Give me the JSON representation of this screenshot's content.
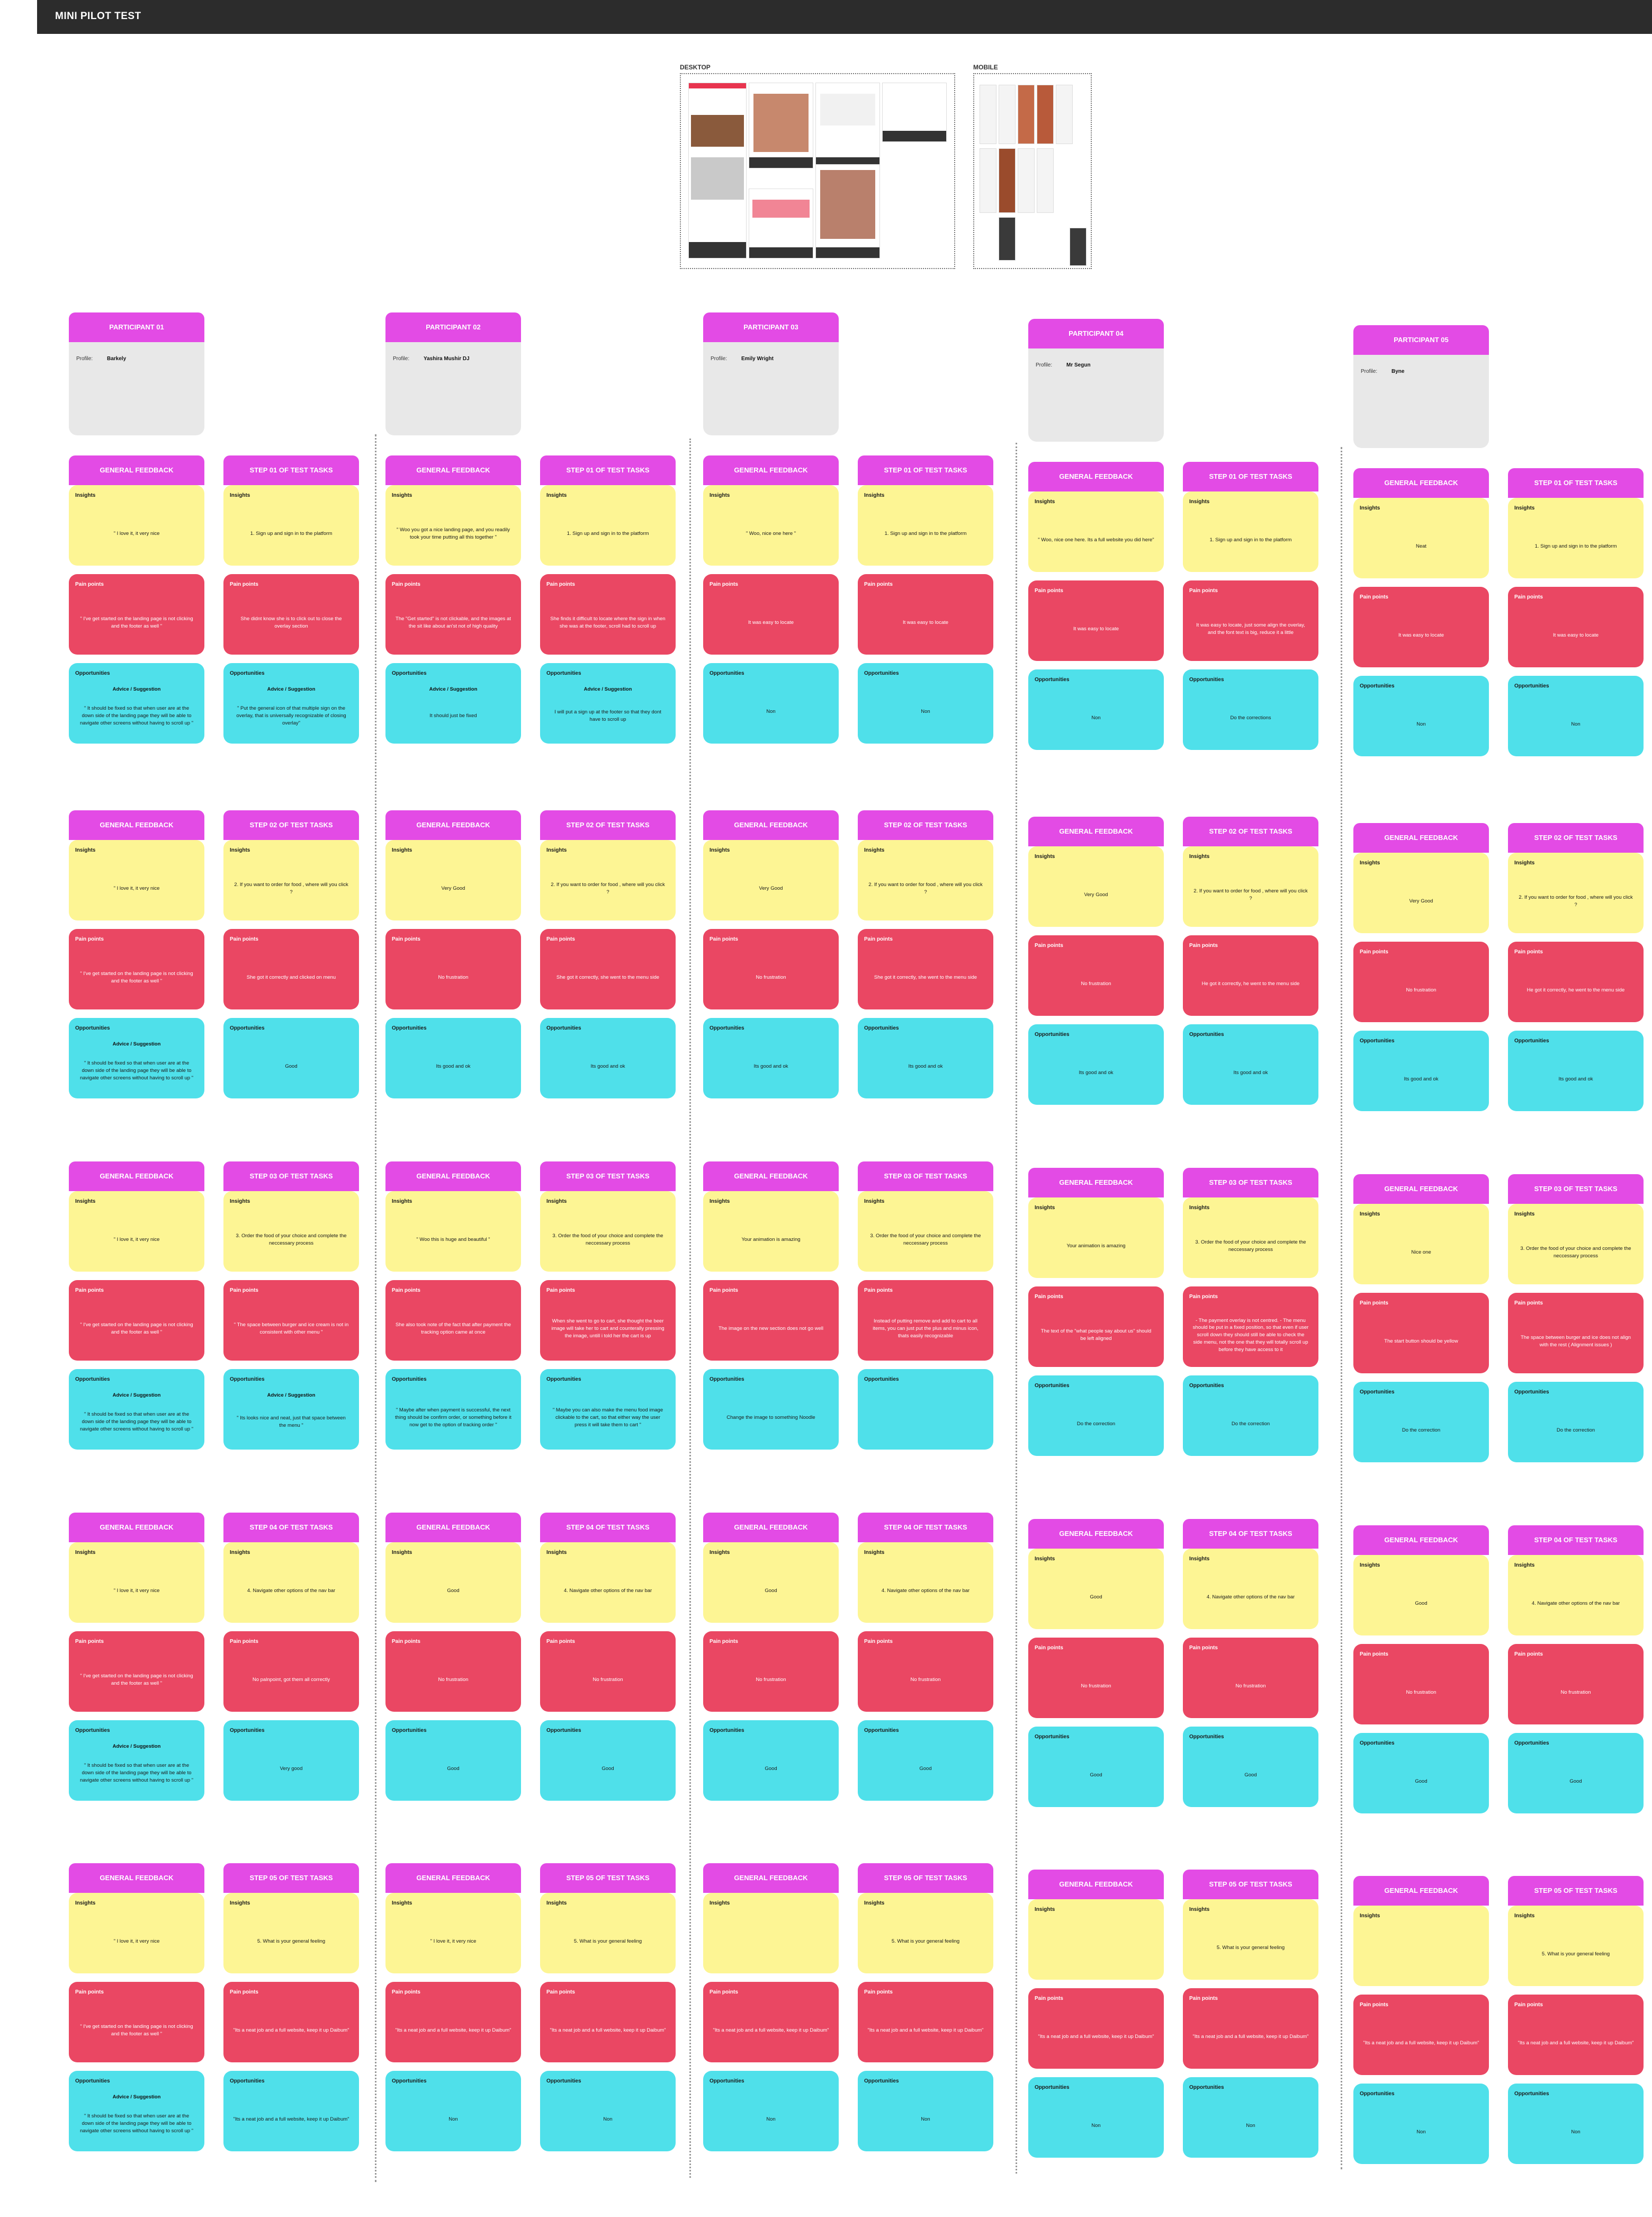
{
  "board": {
    "title": "MINI PILOT TEST"
  },
  "frames": {
    "desktop_label": "DESKTOP",
    "mobile_label": "MOBILE"
  },
  "labels": {
    "general": "GENERAL FEEDBACK",
    "insights": "Insights",
    "pain": "Pain points",
    "opp": "Opportunities",
    "advice": "Advice / Suggestion",
    "profile": "Profile:"
  },
  "colors": {
    "header": "#e34be5",
    "insight": "#fdf594",
    "pain": "#ea4763",
    "opportunity": "#4fe0ea",
    "profile": "#e8e8e8",
    "topbar": "#2c2c2c"
  },
  "participants": [
    {
      "title": "PARTICIPANT 01",
      "name": "Barkely"
    },
    {
      "title": "PARTICIPANT 02",
      "name": "Yashira Mushir DJ"
    },
    {
      "title": "PARTICIPANT 03",
      "name": "Emily Wright"
    },
    {
      "title": "PARTICIPANT 04",
      "name": "Mr Segun"
    },
    {
      "title": "PARTICIPANT 05",
      "name": "Byne"
    }
  ],
  "rows": [
    {
      "step": "STEP 01 OF TEST TASKS",
      "participants": [
        {
          "g": {
            "ins": "\" I love it, it very nice",
            "pain": "\" I've get started on the landing page is not clicking and the footer as well \"",
            "opp": "\" It should be fixed so that when user are at the down side of the landing page they will be able to navigate other screens without having to scroll up \"",
            "adv": true
          },
          "s": {
            "ins": "1. Sign up and sign in to the platform",
            "pain": "She didnt know she is to click out to close the overlay section",
            "opp": "\" Put the general icon of that multiple sign on the overlay, that is universally recognizable of closing overlay\"",
            "adv": true
          }
        },
        {
          "g": {
            "ins": "\" Woo you got a nice landing page, and you readily took your time putting all this together \"",
            "pain": "The \"Get started\" is not clickable, and the images at the sit like about an'st not of high quality",
            "opp": "It should just be fixed",
            "adv": true
          },
          "s": {
            "ins": "1. Sign up and sign in to the platform",
            "pain": "She finds it difficult to locate where the sign in when she was at the footer, scroll had to scroll up",
            "opp": "I will put a sign up at the footer so that they dont have to scroll up",
            "adv": true
          }
        },
        {
          "g": {
            "ins": "\" Woo, nice one here \"",
            "pain": "It was easy to locate",
            "opp": "Non",
            "adv": false
          },
          "s": {
            "ins": "1. Sign up and sign in to the platform",
            "pain": "It was easy to locate",
            "opp": "Non",
            "adv": false
          }
        },
        {
          "g": {
            "ins": "\" Woo, nice one here. Its a full website you did here\"",
            "pain": "It was easy to locate",
            "opp": "Non",
            "adv": false
          },
          "s": {
            "ins": "1. Sign up and sign in to the platform",
            "pain": "It was easy to locate, just some align the overlay, and the font text is big, reduce it a little",
            "opp": "Do the corrections",
            "adv": false
          }
        },
        {
          "g": {
            "ins": "Neat",
            "pain": "It was easy to locate",
            "opp": "Non",
            "adv": false
          },
          "s": {
            "ins": "1. Sign up and sign in to the platform",
            "pain": "It was easy to locate",
            "opp": "Non",
            "adv": false
          }
        }
      ]
    },
    {
      "step": "STEP 02 OF TEST TASKS",
      "participants": [
        {
          "g": {
            "ins": "\" I love it, it very nice",
            "pain": "\" I've get started on the landing page is not clicking and the footer as well \"",
            "opp": "\" It should be fixed so that when user are at the down side of the landing page they will be able to navigate other screens without having to scroll up \"",
            "adv": true
          },
          "s": {
            "ins": "2. If you want to order for food , where will you click ?",
            "pain": "She got it correctly and clicked on menu",
            "opp": "Good",
            "adv": false
          }
        },
        {
          "g": {
            "ins": "Very Good",
            "pain": "No frustration",
            "opp": "Its good and ok",
            "adv": false
          },
          "s": {
            "ins": "2. If you want to order for food , where will you click ?",
            "pain": "She got it correctly, she went to the menu side",
            "opp": "Its good and ok",
            "adv": false
          }
        },
        {
          "g": {
            "ins": "Very Good",
            "pain": "No frustration",
            "opp": "Its good and ok",
            "adv": false
          },
          "s": {
            "ins": "2. If you want to order for food , where will you click ?",
            "pain": "She got it correctly, she went to the menu side",
            "opp": "Its good and ok",
            "adv": false
          }
        },
        {
          "g": {
            "ins": "Very Good",
            "pain": "No frustration",
            "opp": "Its good and ok",
            "adv": false
          },
          "s": {
            "ins": "2. If you want to order for food , where will you click ?",
            "pain": "He got it correctly, he went to the menu side",
            "opp": "Its good and ok",
            "adv": false
          }
        },
        {
          "g": {
            "ins": "Very Good",
            "pain": "No frustration",
            "opp": "Its good and ok",
            "adv": false
          },
          "s": {
            "ins": "2. If you want to order for food , where will you click ?",
            "pain": "He got it correctly, he went to the menu side",
            "opp": "Its good and ok",
            "adv": false
          }
        }
      ]
    },
    {
      "step": "STEP 03 OF TEST TASKS",
      "participants": [
        {
          "g": {
            "ins": "\" I love it, it very nice",
            "pain": "\" I've get started on the landing page is not clicking and the footer as well \"",
            "opp": "\" It should be fixed so that when user are at the down side of the landing page they will be able to navigate other screens without having to scroll up \"",
            "adv": true
          },
          "s": {
            "ins": "3. Order the food of your choice and complete the neccessary process",
            "pain": "\" The space between burger and ice cream is not in consistent with other menu \"",
            "opp": "\" Its looks nice and neat, just that space between the menu \"",
            "adv": true
          }
        },
        {
          "g": {
            "ins": "\" Woo this is huge and beautiful \"",
            "pain": "She also took note of the fact that after payment the tracking option came at once",
            "opp": "\" Maybe after when payment is successful, the next thing should be confirm order, or something before it now get to the option of tracking order \"",
            "adv": false
          },
          "s": {
            "ins": "3. Order the food of your choice and complete the neccessary process",
            "pain": "When she went to go to cart, she thought the beer image will take her to cart and counterally pressing the image, untill i told her the cart is up",
            "opp": "\" Maybe you can also make the menu food image clickable to the cart, so that either way the user press it will take them to cart \"",
            "adv": false
          }
        },
        {
          "g": {
            "ins": "Your animation is amazing",
            "pain": "The image on the new section does not go well",
            "opp": "Change the image to something Noodle",
            "adv": false
          },
          "s": {
            "ins": "3. Order the food of your choice and complete the neccessary process",
            "pain": "Instead of putting remove and add to cart to all items, you can just put the plus and minus icon, thats easily recognizable",
            "opp": "",
            "adv": false
          }
        },
        {
          "g": {
            "ins": "Your animation is amazing",
            "pain": "The text of the \"what people say about us\" should be left aligned",
            "opp": "Do the correction",
            "adv": false
          },
          "s": {
            "ins": "3. Order the food of your choice and complete the neccessary process",
            "pain": "- The payment overlay is not centred. - The menu should be put in a fixed position, so that even if user scroll down they should still be able to check the side menu, not the one that they will totally scroll up before they have access to it",
            "opp": "Do the correction",
            "adv": false
          }
        },
        {
          "g": {
            "ins": "Nice one",
            "pain": "The start button should be yellow",
            "opp": "Do the correction",
            "adv": false
          },
          "s": {
            "ins": "3. Order the food of your choice and complete the neccessary process",
            "pain": "The space between burger and ice does not align with the rest ( Alignment issues )",
            "opp": "Do the correction",
            "adv": false
          }
        }
      ]
    },
    {
      "step": "STEP 04 OF TEST TASKS",
      "participants": [
        {
          "g": {
            "ins": "\" I love it, it very nice",
            "pain": "\" I've get started on the landing page is not clicking and the footer as well \"",
            "opp": "\" It should be fixed so that when user are at the down side of the landing page they will be able to navigate other screens without having to scroll up \"",
            "adv": true
          },
          "s": {
            "ins": "4. Navigate other options of the nav bar",
            "pain": "No palnpoint, got them all correctly",
            "opp": "Very good",
            "adv": false
          }
        },
        {
          "g": {
            "ins": "Good",
            "pain": "No frustration",
            "opp": "Good",
            "adv": false
          },
          "s": {
            "ins": "4. Navigate other options of the nav bar",
            "pain": "No frustration",
            "opp": "Good",
            "adv": false
          }
        },
        {
          "g": {
            "ins": "Good",
            "pain": "No frustration",
            "opp": "Good",
            "adv": false
          },
          "s": {
            "ins": "4. Navigate other options of the nav bar",
            "pain": "No frustration",
            "opp": "Good",
            "adv": false
          }
        },
        {
          "g": {
            "ins": "Good",
            "pain": "No frustration",
            "opp": "Good",
            "adv": false
          },
          "s": {
            "ins": "4. Navigate other options of the nav bar",
            "pain": "No frustration",
            "opp": "Good",
            "adv": false
          }
        },
        {
          "g": {
            "ins": "Good",
            "pain": "No frustration",
            "opp": "Good",
            "adv": false
          },
          "s": {
            "ins": "4. Navigate other options of the nav bar",
            "pain": "No frustration",
            "opp": "Good",
            "adv": false
          }
        }
      ]
    },
    {
      "step": "STEP 05 OF TEST TASKS",
      "participants": [
        {
          "g": {
            "ins": "\" I love it, it very nice",
            "pain": "\" I've get started on the landing page is not clicking and the footer as well \"",
            "opp": "\" It should be fixed so that when user are at the down side of the landing page they will be able to navigate other screens without having to scroll up \"",
            "adv": true
          },
          "s": {
            "ins": "5. What is your general feeling",
            "pain": "\"Its a neat job and a full website, keep it up Daibum\"",
            "opp": "\"Its a neat job and a full website, keep it up Daibum\"",
            "adv": false
          }
        },
        {
          "g": {
            "ins": "\" I love it, it very nice",
            "pain": "\"Its a neat job and a full website, keep it up Daibum\"",
            "opp": "Non",
            "adv": false
          },
          "s": {
            "ins": "5. What is your general feeling",
            "pain": "\"Its a neat job and a full website, keep it up Daibum\"",
            "opp": "Non",
            "adv": false
          }
        },
        {
          "g": {
            "ins": "",
            "pain": "\"Its a neat job and a full website, keep it up Daibum\"",
            "opp": "Non",
            "adv": false
          },
          "s": {
            "ins": "5. What is your general feeling",
            "pain": "\"Its a neat job and a full website, keep it up Daibum\"",
            "opp": "Non",
            "adv": false
          }
        },
        {
          "g": {
            "ins": "",
            "pain": "\"Its a neat job and a full website, keep it up Daibum\"",
            "opp": "Non",
            "adv": false
          },
          "s": {
            "ins": "5. What is your general feeling",
            "pain": "\"Its a neat job and a full website, keep it up Daibum\"",
            "opp": "Non",
            "adv": false
          }
        },
        {
          "g": {
            "ins": "",
            "pain": "\"Its a neat job and a full website, keep it up Daibum\"",
            "opp": "Non",
            "adv": false
          },
          "s": {
            "ins": "5. What is your general feeling",
            "pain": "\"Its a neat job and a full website, keep it up Daibum\"",
            "opp": "Non",
            "adv": false
          }
        }
      ]
    }
  ]
}
